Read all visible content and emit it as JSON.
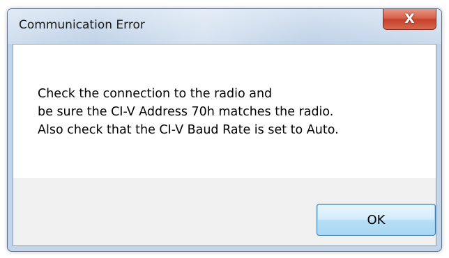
{
  "window": {
    "title": "Communication Error",
    "close_glyph": "X",
    "close_icon": "close-icon"
  },
  "message": {
    "lines": [
      "Check the connection to the radio and",
      "be sure the CI-V Address 70h matches the radio.",
      "Also check that the CI-V Baud Rate is set to Auto."
    ]
  },
  "buttons": {
    "ok_label": "OK"
  },
  "colors": {
    "titlebar": "#bfd2e8",
    "close_button": "#d05a43",
    "button_area": "#f0f0f0",
    "ok_button_border": "#3c7fb1"
  }
}
